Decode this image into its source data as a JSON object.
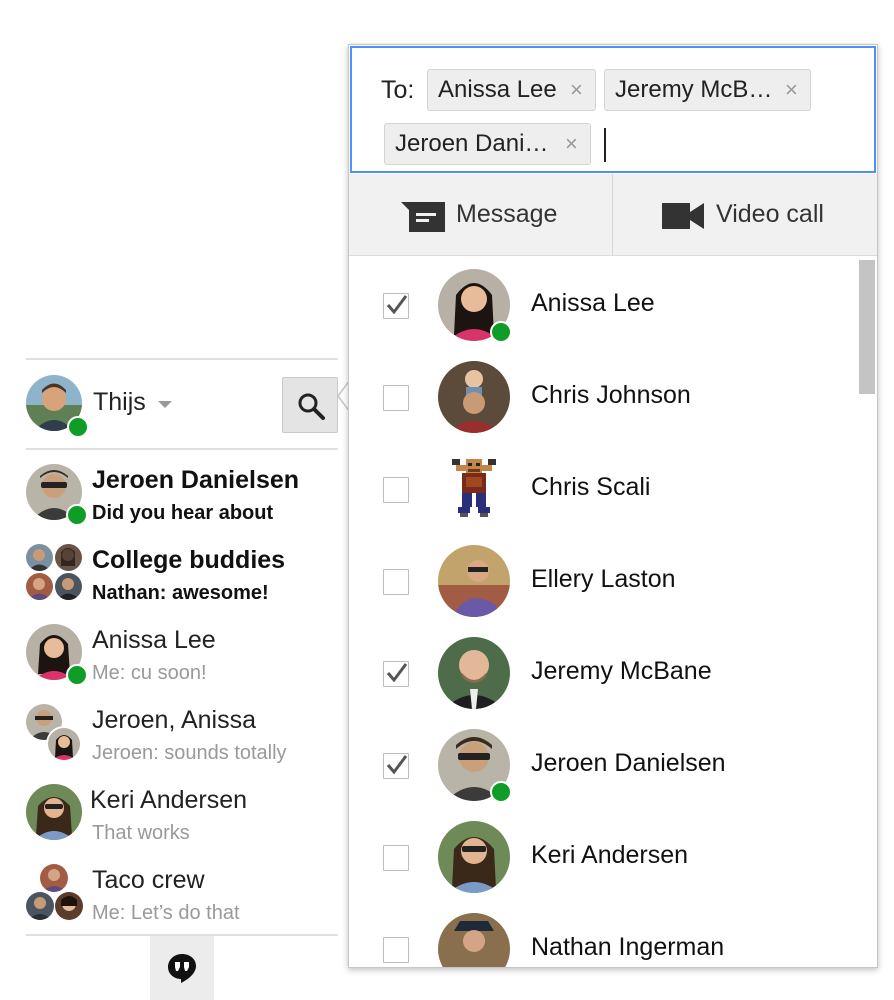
{
  "current_user": {
    "name": "Thijs",
    "online": true
  },
  "conversations": [
    {
      "title": "Jeroen Danielsen",
      "snippet": "Did you hear about",
      "unread": true,
      "online": true
    },
    {
      "title": "College buddies",
      "snippet": "Nathan: awesome!",
      "unread": true,
      "online": false
    },
    {
      "title": "Anissa Lee",
      "snippet": "Me: cu soon!",
      "unread": false,
      "online": true
    },
    {
      "title": "Jeroen, Anissa",
      "snippet": "Jeroen: sounds totally",
      "unread": false,
      "online": false
    },
    {
      "title": "Keri Andersen",
      "snippet": "That works",
      "unread": false,
      "online": false
    },
    {
      "title": "Taco crew",
      "snippet": "Me: Let’s do that",
      "unread": false,
      "online": false
    }
  ],
  "compose": {
    "to_label": "To:",
    "recipients": [
      "Anissa Lee",
      "Jeremy McB…",
      "Jeroen Dani…"
    ],
    "remove_glyph": "×"
  },
  "actions": {
    "message": "Message",
    "video_call": "Video call"
  },
  "contacts": [
    {
      "name": "Anissa Lee",
      "checked": true,
      "online": true
    },
    {
      "name": "Chris Johnson",
      "checked": false,
      "online": false
    },
    {
      "name": "Chris Scali",
      "checked": false,
      "online": false
    },
    {
      "name": "Ellery Laston",
      "checked": false,
      "online": false
    },
    {
      "name": "Jeremy McBane",
      "checked": true,
      "online": false
    },
    {
      "name": "Jeroen Danielsen",
      "checked": true,
      "online": true
    },
    {
      "name": "Keri Andersen",
      "checked": false,
      "online": false
    },
    {
      "name": "Nathan Ingerman",
      "checked": false,
      "online": false
    }
  ],
  "colors": {
    "accent_blue": "#4d90fe",
    "presence_green": "#0f9d28",
    "unread_text": "#111111",
    "read_snippet": "#999999"
  }
}
